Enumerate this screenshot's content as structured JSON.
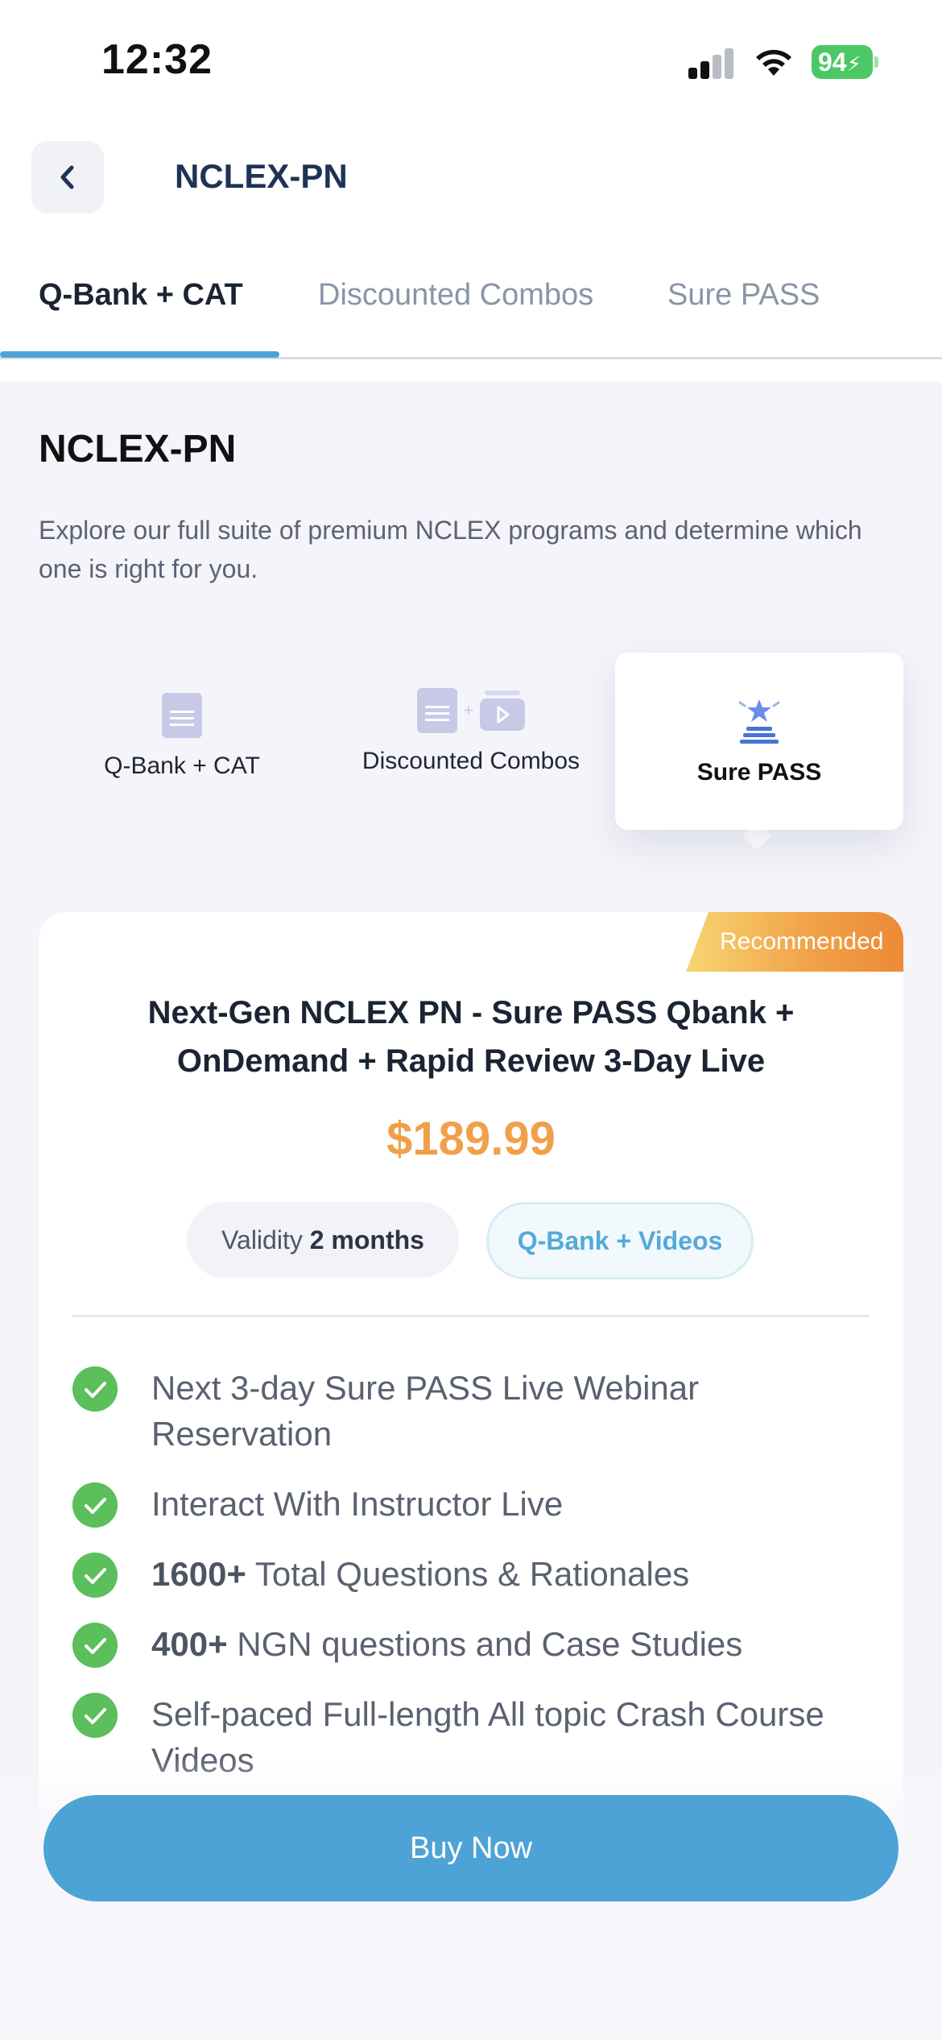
{
  "status_bar": {
    "time": "12:32",
    "battery": "94"
  },
  "header": {
    "title": "NCLEX-PN"
  },
  "tabs": [
    {
      "label": "Q-Bank + CAT",
      "active": true
    },
    {
      "label": "Discounted Combos",
      "active": false
    },
    {
      "label": "Sure PASS",
      "active": false
    }
  ],
  "section": {
    "title": "NCLEX-PN",
    "description": "Explore our full suite of premium NCLEX programs and determine which one is right for you."
  },
  "categories": [
    {
      "label": "Q-Bank + CAT",
      "icon": "document-icon",
      "selected": false
    },
    {
      "label": "Discounted Combos",
      "icon": "document-video-icon",
      "selected": false
    },
    {
      "label": "Sure PASS",
      "icon": "podium-star-icon",
      "selected": true
    }
  ],
  "product": {
    "badge": "Recommended",
    "title": "Next-Gen NCLEX PN - Sure PASS Qbank + OnDemand + Rapid Review 3-Day Live",
    "price": "$189.99",
    "validity_label": "Validity",
    "validity_value": "2 months",
    "type": "Q-Bank + Videos",
    "features": [
      {
        "bold": "",
        "text": "Next 3-day Sure PASS Live Webinar Reservation"
      },
      {
        "bold": "",
        "text": "Interact With Instructor Live"
      },
      {
        "bold": "1600+",
        "text": " Total Questions & Rationales"
      },
      {
        "bold": "400+",
        "text": " NGN questions and Case Studies"
      },
      {
        "bold": "",
        "text": "Self-paced Full-length All topic Crash Course Videos"
      }
    ]
  },
  "buy_button": {
    "label": "Buy Now"
  },
  "colors": {
    "accent": "#4ea3d6",
    "price": "#f0a04a",
    "check": "#5bbf5b",
    "badge_start": "#f7d571",
    "badge_end": "#ec8a35"
  }
}
